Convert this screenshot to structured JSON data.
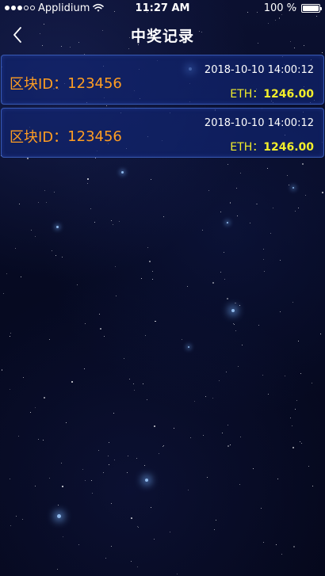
{
  "status_bar": {
    "carrier": "Applidium",
    "time": "11:27 AM",
    "battery_percent_text": "100 %",
    "battery_level": 1.0,
    "signal_icon": "signal-dots-icon",
    "wifi_icon": "wifi-icon"
  },
  "nav": {
    "title": "中奖记录",
    "back_icon": "chevron-left-icon"
  },
  "records": [
    {
      "block_label": "区块ID：",
      "block_id": "123456",
      "time": "2018-10-10 14:00:12",
      "currency_label": "ETH：",
      "amount": "1246.00"
    },
    {
      "block_label": "区块ID：",
      "block_id": "123456",
      "time": "2018-10-10 14:00:12",
      "currency_label": "ETH：",
      "amount": "1246.00"
    }
  ],
  "colors": {
    "background": "#070a1e",
    "card_background": "#12267a",
    "card_border": "#466ed2",
    "block_id_text": "#ff9d22",
    "amount_text": "#f2ee2a",
    "time_text": "#ffffff"
  }
}
